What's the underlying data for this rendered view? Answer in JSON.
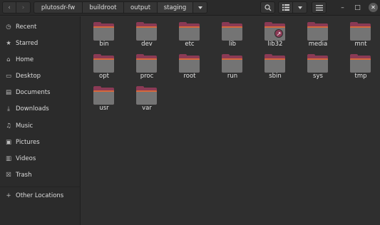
{
  "header": {
    "back_glyph": "‹",
    "forward_glyph": "›",
    "breadcrumbs": [
      "plutosdr-fw",
      "buildroot",
      "output",
      "staging"
    ],
    "search_icon": "search-icon",
    "view_icon": "list-view-icon",
    "menu_icon": "hamburger-icon",
    "minimize_glyph": "–",
    "maximize_glyph": "□",
    "close_glyph": "✕"
  },
  "sidebar": {
    "items": [
      {
        "label": "Recent",
        "icon": "clock-icon",
        "glyph": "◷"
      },
      {
        "label": "Starred",
        "icon": "star-icon",
        "glyph": "★"
      },
      {
        "label": "Home",
        "icon": "home-icon",
        "glyph": "⌂"
      },
      {
        "label": "Desktop",
        "icon": "desktop-icon",
        "glyph": "▭"
      },
      {
        "label": "Documents",
        "icon": "document-icon",
        "glyph": "▤"
      },
      {
        "label": "Downloads",
        "icon": "download-icon",
        "glyph": "⤓"
      },
      {
        "label": "Music",
        "icon": "music-icon",
        "glyph": "♫"
      },
      {
        "label": "Pictures",
        "icon": "picture-icon",
        "glyph": "▣"
      },
      {
        "label": "Videos",
        "icon": "video-icon",
        "glyph": "▥"
      },
      {
        "label": "Trash",
        "icon": "trash-icon",
        "glyph": "☒"
      },
      {
        "label": "Other Locations",
        "icon": "plus-icon",
        "glyph": "+"
      }
    ]
  },
  "files": [
    {
      "name": "bin"
    },
    {
      "name": "dev"
    },
    {
      "name": "etc"
    },
    {
      "name": "lib"
    },
    {
      "name": "lib32",
      "symlink": true
    },
    {
      "name": "media"
    },
    {
      "name": "mnt"
    },
    {
      "name": "opt"
    },
    {
      "name": "proc"
    },
    {
      "name": "root"
    },
    {
      "name": "run"
    },
    {
      "name": "sbin"
    },
    {
      "name": "sys"
    },
    {
      "name": "tmp"
    },
    {
      "name": "usr"
    },
    {
      "name": "var"
    }
  ],
  "colors": {
    "folder_body": "#747474",
    "folder_accent": "#8b3a55",
    "folder_edge": "#d9673a"
  }
}
